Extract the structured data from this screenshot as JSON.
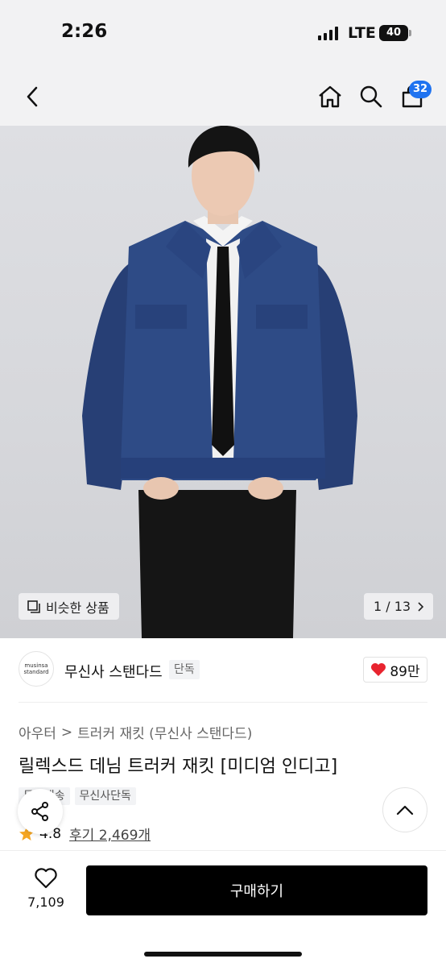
{
  "status_bar": {
    "time": "2:26",
    "network": "LTE",
    "battery": "40"
  },
  "header": {
    "back_icon": "chevron-left-icon",
    "home_icon": "home-icon",
    "search_icon": "search-icon",
    "cart_icon": "shopping-bag-icon",
    "cart_count": "32"
  },
  "gallery": {
    "similar_label": "비슷한 상품",
    "counter": "1 / 13",
    "counter_icon": "chevron-right-icon"
  },
  "brand": {
    "logo_line1": "musinsa",
    "logo_line2": "standard",
    "name": "무신사 스탠다드",
    "tag": "단독",
    "likes": "89만"
  },
  "product": {
    "breadcrumb_category": "아우터",
    "breadcrumb_sep": ">",
    "breadcrumb_sub": "트러커 재킷 (무신사 스탠다드)",
    "title": "릴렉스드 데님 트러커 재킷 [미디엄 인디고]",
    "tags": [
      "무료배송",
      "무신사단독"
    ],
    "rating": "4.8",
    "reviews": "후기 2,469개"
  },
  "bottom_bar": {
    "wish_count": "7,109",
    "buy_label": "구매하기"
  },
  "colors": {
    "accent": "#1f73f0",
    "heart": "#e8242f",
    "star": "#f5a623",
    "buy_button": "#000000"
  }
}
